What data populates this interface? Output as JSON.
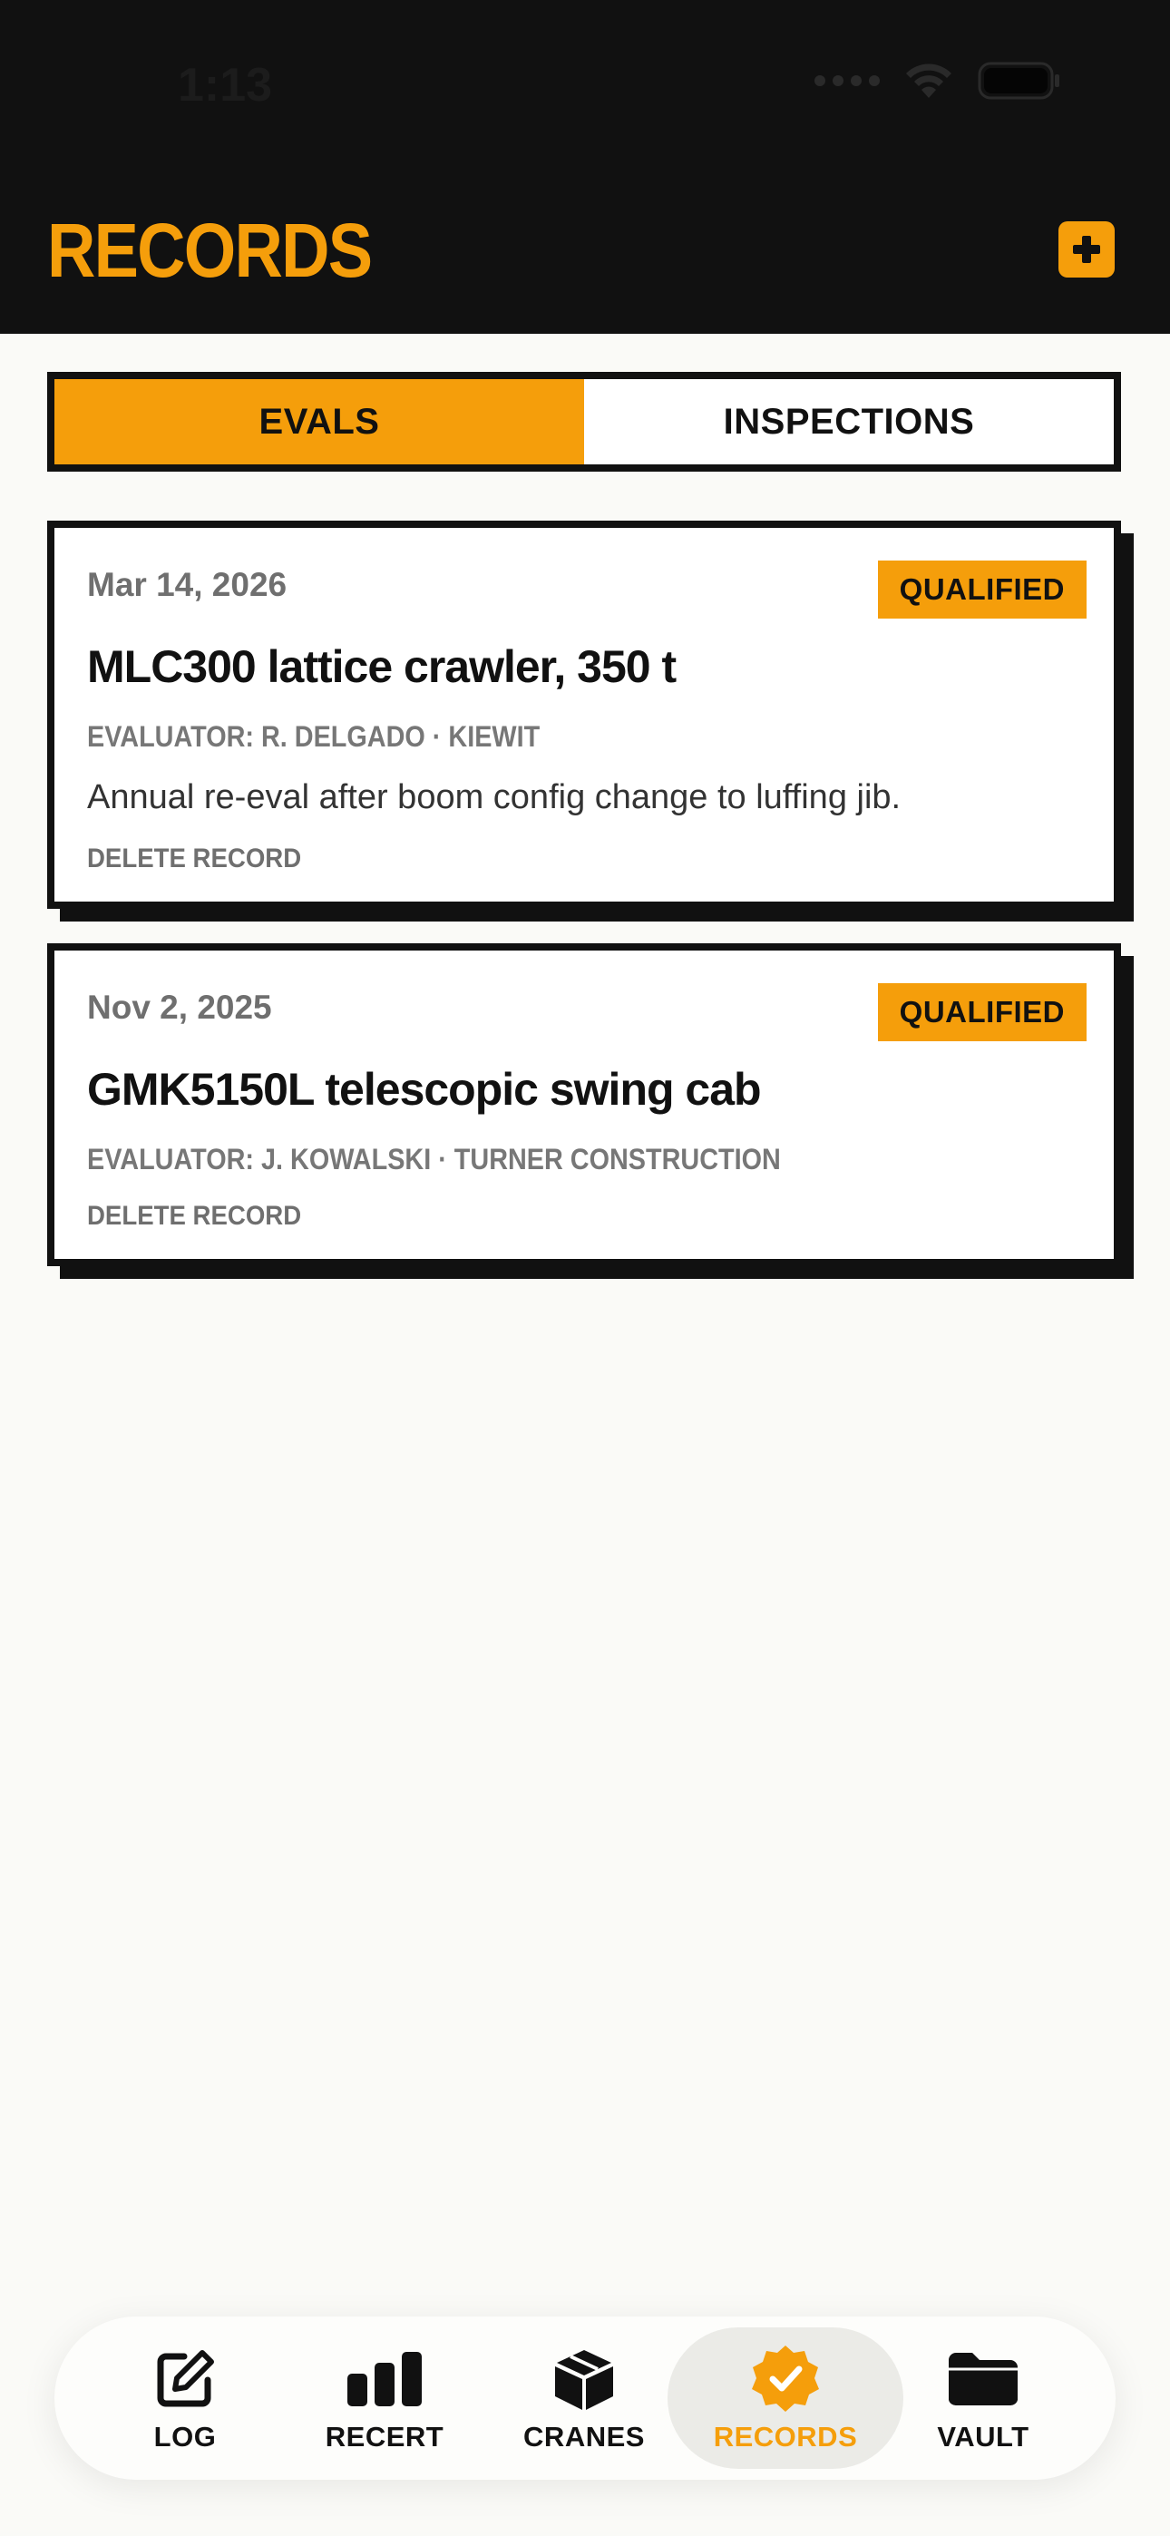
{
  "status_bar": {
    "time": "1:13"
  },
  "header": {
    "title": "RECORDS"
  },
  "segments": [
    {
      "label": "EVALS",
      "active": true
    },
    {
      "label": "INSPECTIONS",
      "active": false
    }
  ],
  "records": [
    {
      "date": "Mar 14, 2026",
      "badge": "QUALIFIED",
      "title": "MLC300 lattice crawler, 350 t",
      "meta": "EVALUATOR: R. DELGADO · KIEWIT",
      "note": "Annual re-eval after boom config change to luffing jib.",
      "delete_label": "DELETE RECORD"
    },
    {
      "date": "Nov 2, 2025",
      "badge": "QUALIFIED",
      "title": "GMK5150L telescopic swing cab",
      "meta": "EVALUATOR: J. KOWALSKI · TURNER CONSTRUCTION",
      "delete_label": "DELETE RECORD"
    }
  ],
  "tabbar": [
    {
      "label": "LOG",
      "icon": "edit-icon"
    },
    {
      "label": "RECERT",
      "icon": "bar-chart-icon"
    },
    {
      "label": "CRANES",
      "icon": "box-icon"
    },
    {
      "label": "RECORDS",
      "icon": "badge-check-icon",
      "active": true
    },
    {
      "label": "VAULT",
      "icon": "folder-icon"
    }
  ],
  "colors": {
    "accent": "#f59e0b",
    "ink": "#111111",
    "background": "#fafaf7"
  }
}
